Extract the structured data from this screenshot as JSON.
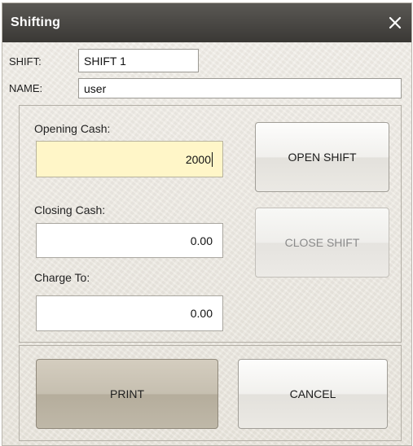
{
  "window": {
    "title": "Shifting",
    "close_icon": "close-icon"
  },
  "shift": {
    "label": "SHIFT:",
    "value": "SHIFT 1"
  },
  "name": {
    "label": "NAME:",
    "value": "user"
  },
  "opening_cash": {
    "label": "Opening Cash:",
    "value": "2000"
  },
  "closing_cash": {
    "label": "Closing Cash:",
    "value": "0.00"
  },
  "charge_to": {
    "label": "Charge To:",
    "value": "0.00"
  },
  "buttons": {
    "open_shift": "OPEN SHIFT",
    "close_shift": "CLOSE SHIFT",
    "print": "PRINT",
    "cancel": "CANCEL"
  },
  "colors": {
    "titlebar": "#46443f",
    "active_field": "#fff6c8",
    "dialog_bg": "#eeebe3",
    "disabled_text": "#8a8a8a"
  }
}
